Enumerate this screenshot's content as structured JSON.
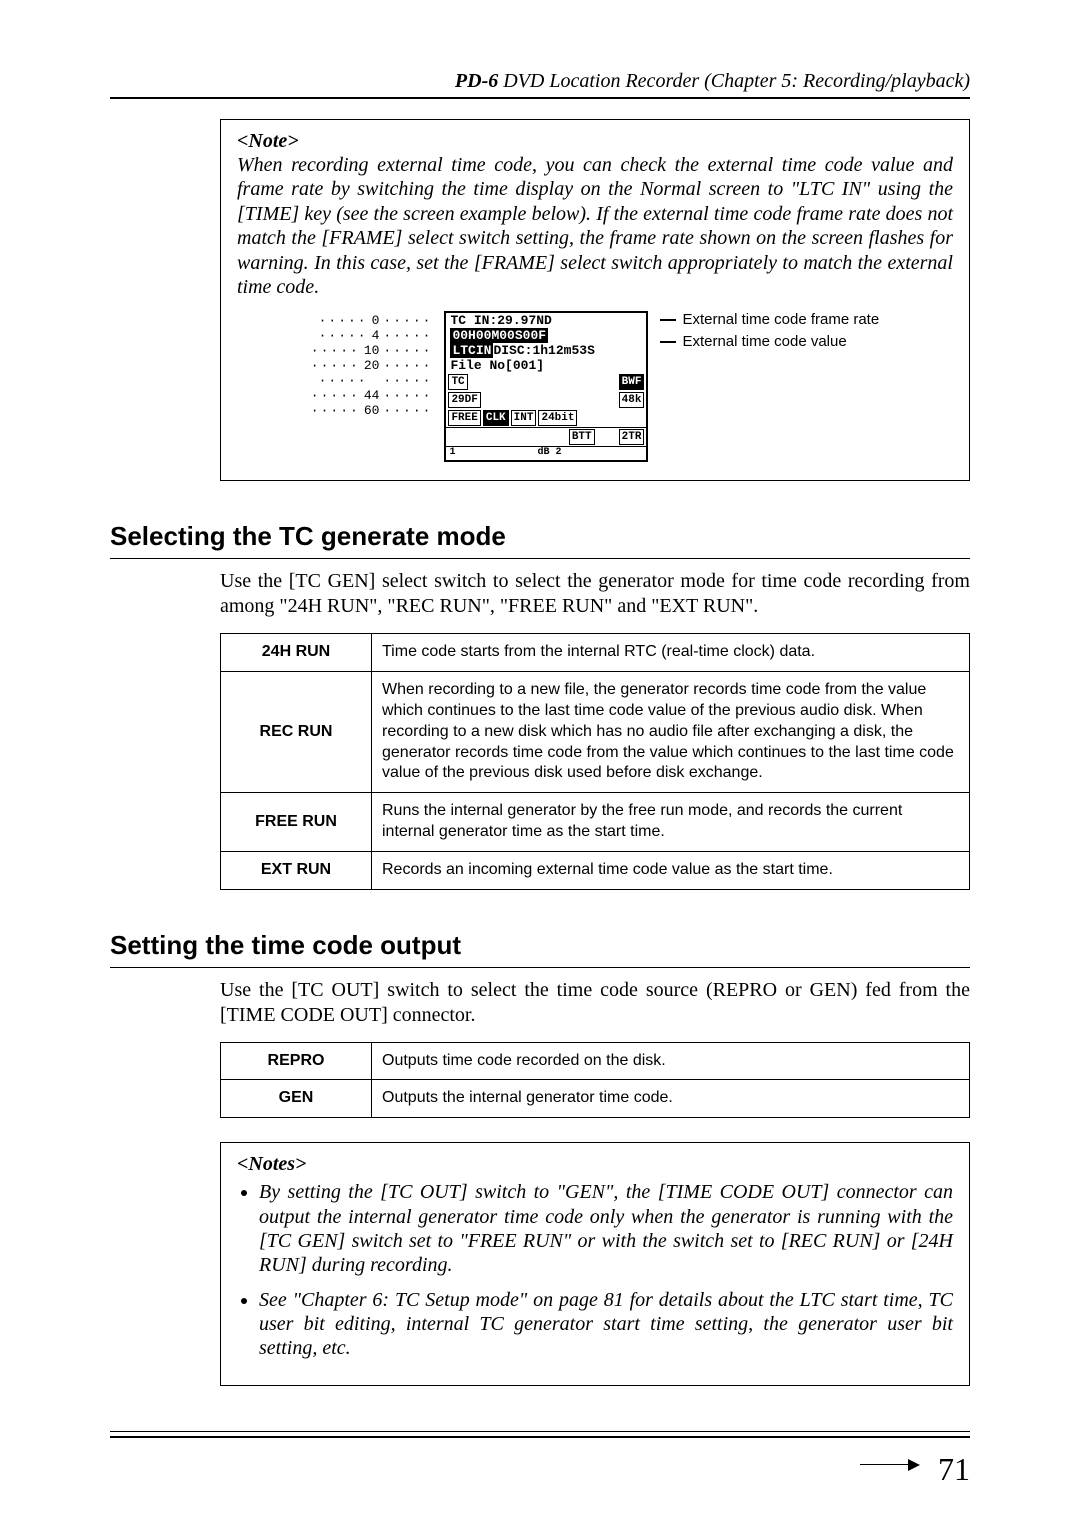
{
  "header": {
    "model": "PD-6",
    "rest": " DVD Location Recorder (Chapter 5: Recording/playback)"
  },
  "note1": {
    "title": "<Note>",
    "body": "When recording external time code, you can check the external time code value and frame rate by switching the time display on the Normal screen to \"LTC IN\" using the [TIME] key (see the screen example below). If the external time code frame rate does not match the [FRAME] select switch setting, the frame rate shown on the screen flashes for warning. In this case, set the [FRAME] select switch appropriately to match the external time code."
  },
  "lcd": {
    "scale": [
      "0",
      "4",
      "10",
      "20",
      "",
      "44",
      "60"
    ],
    "bottom_scale_left": "1",
    "bottom_scale_mid": "dB   2",
    "line1": "TC IN:29.97ND",
    "line2": "00H00M00S00F",
    "line3_tag": "LTCIN",
    "line3_rest": "DISC:1h12m53S",
    "line4": "File No[001]",
    "status": {
      "tc": "TC",
      "bwf": "BWF",
      "df": "29DF",
      "khz": "48k",
      "free": "FREE",
      "clk": "CLK",
      "int": "INT",
      "bit": "24bit",
      "btt": "BTT",
      "tr": "2TR"
    },
    "annotations": {
      "frame_rate": "External time code frame rate",
      "value": "External time code value"
    }
  },
  "section1": {
    "heading": "Selecting the TC generate mode",
    "intro": "Use the [TC GEN] select switch to select the generator mode for time code recording from among \"24H RUN\", \"REC RUN\", \"FREE RUN\" and \"EXT RUN\".",
    "rows": [
      {
        "mode": "24H RUN",
        "desc": "Time code starts from the internal RTC (real-time clock) data."
      },
      {
        "mode": "REC RUN",
        "desc": "When recording to a new file, the generator records time code from the value which continues to the last time code value of the previous audio disk. When recording to a new disk which has no audio file after exchanging a disk, the generator records time code from the value which continues to the last time code value of the previous disk used before disk exchange."
      },
      {
        "mode": "FREE RUN",
        "desc": "Runs the internal generator by the free run mode, and records the current internal generator time as the start time."
      },
      {
        "mode": "EXT RUN",
        "desc": "Records an incoming external time code value as the start time."
      }
    ]
  },
  "section2": {
    "heading": "Setting the time code output",
    "intro": "Use the [TC OUT] switch to select the time code source (REPRO or GEN) fed from the [TIME CODE OUT] connector.",
    "rows": [
      {
        "mode": "REPRO",
        "desc": "Outputs time code recorded on the disk."
      },
      {
        "mode": "GEN",
        "desc": "Outputs the internal generator time code."
      }
    ]
  },
  "notes2": {
    "title": "<Notes>",
    "items": [
      "By setting the [TC OUT] switch to \"GEN\", the [TIME CODE OUT] connector can output the internal generator time code only when the generator is running with the [TC GEN] switch set to \"FREE RUN\" or with the switch set to [REC RUN] or [24H RUN] during recording.",
      "See \"Chapter 6: TC Setup mode\" on page 81 for details about the LTC start time, TC user bit editing, internal TC generator start time setting, the generator user bit setting, etc."
    ]
  },
  "page_number": "71"
}
